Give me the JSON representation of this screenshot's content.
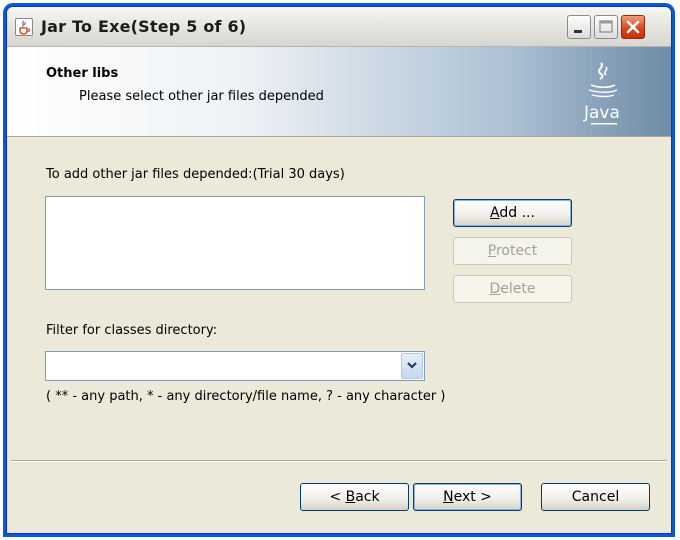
{
  "window": {
    "title": "Jar To Exe(Step 5 of 6)"
  },
  "header": {
    "title": "Other libs",
    "subtitle": "Please select other jar files depended",
    "logo_text": "Java"
  },
  "main": {
    "jars_label": "To add other jar files depended:(Trial 30 days)",
    "buttons": {
      "add": {
        "label": "Add ...",
        "mnemonic": "A",
        "rest": "dd ..."
      },
      "protect": {
        "label": "Protect",
        "mnemonic": "P",
        "rest": "rotect"
      },
      "delete": {
        "label": "Delete",
        "mnemonic": "D",
        "rest": "elete"
      }
    },
    "filter_label": "Filter for classes directory:",
    "filter_value": "",
    "filter_hint": "( ** - any path, * - any directory/file name, ? - any character )"
  },
  "footer": {
    "back": {
      "label": "< Back",
      "prefix": "< ",
      "mnemonic": "B",
      "rest": "ack"
    },
    "next": {
      "label": "Next >",
      "mnemonic": "N",
      "rest": "ext >"
    },
    "cancel": {
      "label": "Cancel"
    }
  },
  "icons": {
    "app": "java-cup-icon",
    "minimize": "minimize-icon",
    "maximize": "maximize-icon",
    "close": "close-icon",
    "dropdown": "chevron-down-icon"
  }
}
